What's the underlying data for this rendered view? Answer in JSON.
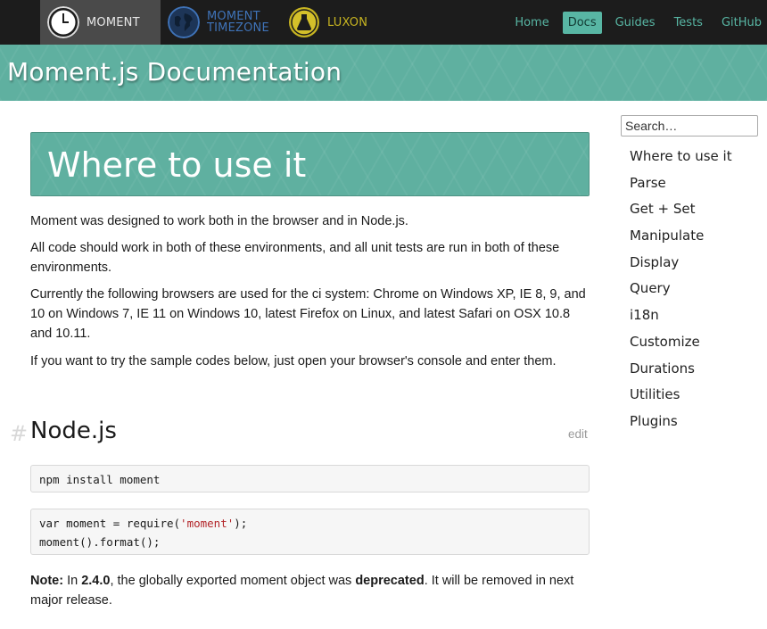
{
  "nav": {
    "brands": [
      {
        "label": "MOMENT",
        "icon": "clock-icon"
      },
      {
        "label_line1": "MOMENT",
        "label_line2": "TIMEZONE",
        "icon": "globe-icon"
      },
      {
        "label": "LUXON",
        "icon": "flask-icon"
      }
    ],
    "links": [
      "Home",
      "Docs",
      "Guides",
      "Tests",
      "GitHub"
    ],
    "active_link": "Docs",
    "colors": {
      "bar": "#1c1c1c",
      "accent": "#58b6a4",
      "timezone": "#3f73b8",
      "luxon": "#c7b421"
    }
  },
  "header": {
    "title": "Moment.js Documentation"
  },
  "sidebar": {
    "search_placeholder": "Search…",
    "items": [
      "Where to use it",
      "Parse",
      "Get + Set",
      "Manipulate",
      "Display",
      "Query",
      "i18n",
      "Customize",
      "Durations",
      "Utilities",
      "Plugins"
    ]
  },
  "main": {
    "banner_title": "Where to use it",
    "paragraphs": [
      "Moment was designed to work both in the browser and in Node.js.",
      "All code should work in both of these environments, and all unit tests are run in both of these environments.",
      "Currently the following browsers are used for the ci system: Chrome on Windows XP, IE 8, 9, and 10 on Windows 7, IE 11 on Windows 10, latest Firefox on Linux, and latest Safari on OSX 10.8 and 10.11.",
      "If you want to try the sample codes below, just open your browser's console and enter them."
    ],
    "section": {
      "hash": "#",
      "title": "Node.js",
      "edit": "edit"
    },
    "code1": "npm install moment",
    "code2": {
      "line1_pre": "var moment = require(",
      "line1_str": "'moment'",
      "line1_post": ");",
      "line2": "moment().format();"
    },
    "note": {
      "label": "Note:",
      "t1": " In ",
      "version": "2.4.0",
      "t2": ", the globally exported moment object was ",
      "deprecated": "deprecated",
      "t3": ". It will be removed in next major release."
    }
  },
  "colors": {
    "teal": "#5fb0a0",
    "code_string": "#b3262a"
  }
}
